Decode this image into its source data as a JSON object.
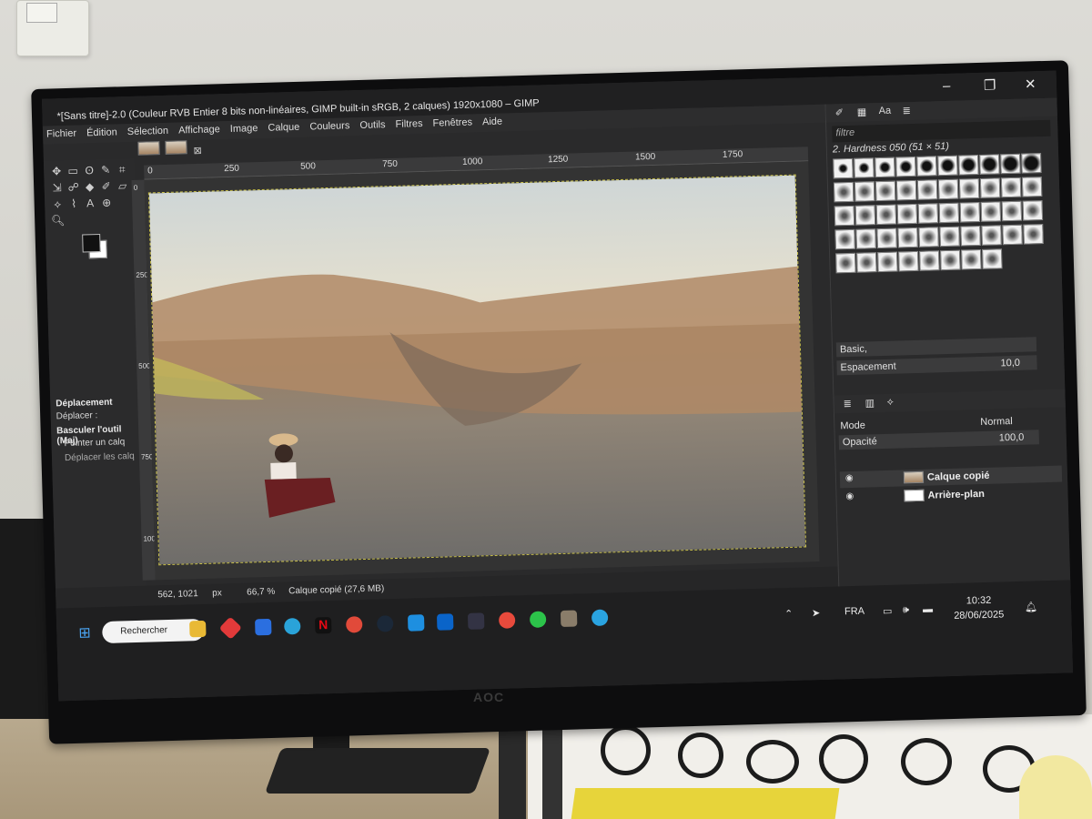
{
  "window": {
    "title": "*[Sans titre]-2.0 (Couleur RVB Entier 8 bits non-linéaires, GIMP built-in sRGB, 2 calques) 1920x1080 – GIMP",
    "minimize": "–",
    "maximize": "❐",
    "close": "✕"
  },
  "menu": [
    "Fichier",
    "Édition",
    "Sélection",
    "Affichage",
    "Image",
    "Calque",
    "Couleurs",
    "Outils",
    "Filtres",
    "Fenêtres",
    "Aide"
  ],
  "ruler": {
    "ticks": [
      "0",
      "250",
      "500",
      "750",
      "1000",
      "1250",
      "1500",
      "1750"
    ],
    "left_ticks": [
      "0",
      "250",
      "500",
      "750",
      "1000"
    ]
  },
  "tool_options": {
    "title": "Déplacement",
    "move_label": "Déplacer :",
    "toggle_label": "Basculer l'outil (Maj)",
    "option_1": "Pointer un calq",
    "option_2": "Déplacer les calq"
  },
  "status": {
    "coords": "562, 1021",
    "unit": "px",
    "zoom": "66,7 %",
    "layer_info": "Calque copié (27,6 MB)"
  },
  "brushes": {
    "filter_placeholder": "filtre",
    "selected": "2. Hardness 050 (51 × 51)",
    "preset": "Basic,",
    "spacing_label": "Espacement",
    "spacing_value": "10,0"
  },
  "layers": {
    "mode_label": "Mode",
    "mode_value": "Normal",
    "opacity_label": "Opacité",
    "opacity_value": "100,0",
    "items": [
      "Calque copié",
      "Arrière-plan"
    ]
  },
  "taskbar": {
    "search": "Rechercher",
    "lang": "FRA",
    "time": "10:32",
    "date": "28/06/2025"
  },
  "monitor_brand": "AOC"
}
